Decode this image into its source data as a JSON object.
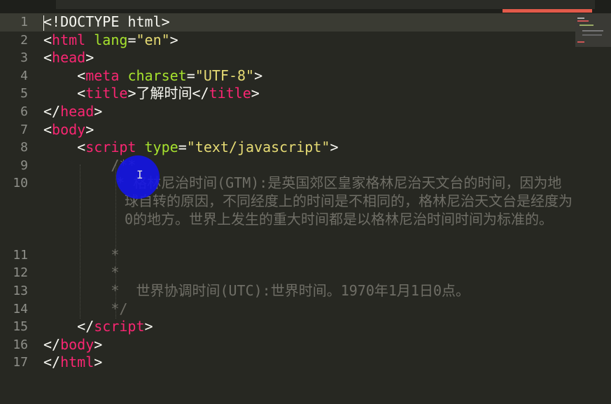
{
  "editor": {
    "theme_colors": {
      "background": "#272822",
      "tag": "#f92672",
      "attribute": "#a6e22e",
      "string": "#e6db74",
      "text": "#f8f8f2",
      "comment": "#6f6e66",
      "gutter": "#8f908a",
      "active_tab": "#e25a4a"
    },
    "lines": [
      {
        "n": "1",
        "tokens": [
          [
            "text",
            "<!DOCTYPE html>"
          ]
        ]
      },
      {
        "n": "2",
        "tokens": [
          [
            "text",
            "<"
          ],
          [
            "tag",
            "html"
          ],
          [
            "text",
            " "
          ],
          [
            "attr",
            "lang"
          ],
          [
            "text",
            "="
          ],
          [
            "str",
            "\"en\""
          ],
          [
            "text",
            ">"
          ]
        ]
      },
      {
        "n": "3",
        "tokens": [
          [
            "text",
            "<"
          ],
          [
            "tag",
            "head"
          ],
          [
            "text",
            ">"
          ]
        ]
      },
      {
        "n": "4",
        "tokens": [
          [
            "text",
            "    <"
          ],
          [
            "tag",
            "meta"
          ],
          [
            "text",
            " "
          ],
          [
            "attr",
            "charset"
          ],
          [
            "text",
            "="
          ],
          [
            "str",
            "\"UTF-8\""
          ],
          [
            "text",
            ">"
          ]
        ]
      },
      {
        "n": "5",
        "tokens": [
          [
            "text",
            "    <"
          ],
          [
            "tag",
            "title"
          ],
          [
            "text",
            ">了解时间</"
          ],
          [
            "tag",
            "title"
          ],
          [
            "text",
            ">"
          ]
        ]
      },
      {
        "n": "6",
        "tokens": [
          [
            "text",
            "</"
          ],
          [
            "tag",
            "head"
          ],
          [
            "text",
            ">"
          ]
        ]
      },
      {
        "n": "7",
        "tokens": [
          [
            "text",
            "<"
          ],
          [
            "tag",
            "body"
          ],
          [
            "text",
            ">"
          ]
        ]
      },
      {
        "n": "8",
        "tokens": [
          [
            "text",
            "    <"
          ],
          [
            "tag",
            "script"
          ],
          [
            "text",
            " "
          ],
          [
            "attr",
            "type"
          ],
          [
            "text",
            "="
          ],
          [
            "str",
            "\"text/javascript\""
          ],
          [
            "text",
            ">"
          ]
        ]
      },
      {
        "n": "9",
        "tokens": [
          [
            "cm",
            "        /**"
          ]
        ]
      },
      {
        "n": "10",
        "wrapped": true,
        "tokens": [
          [
            "cm",
            "* 格林尼治时间(GTM):是英国郊区皇家格林尼治天文台的时间，因为地球自转的原因，不同经度上的时间是不相同的，格林尼治天文台是经度为0的地方。世界上发生的重大时间都是以格林尼治时间时间为标准的。"
          ]
        ]
      },
      {
        "n": "11",
        "tokens": [
          [
            "cm",
            "        *"
          ]
        ]
      },
      {
        "n": "12",
        "tokens": [
          [
            "cm",
            "        *"
          ]
        ]
      },
      {
        "n": "13",
        "tokens": [
          [
            "cm",
            "        *  世界协调时间(UTC):世界时间。1970年1月1日0点。"
          ]
        ]
      },
      {
        "n": "14",
        "tokens": [
          [
            "cm",
            "        */"
          ]
        ]
      },
      {
        "n": "15",
        "tokens": [
          [
            "text",
            "    </"
          ],
          [
            "tag",
            "script"
          ],
          [
            "text",
            ">"
          ]
        ]
      },
      {
        "n": "16",
        "tokens": [
          [
            "text",
            "</"
          ],
          [
            "tag",
            "body"
          ],
          [
            "text",
            ">"
          ]
        ]
      },
      {
        "n": "17",
        "tokens": [
          [
            "text",
            "</"
          ],
          [
            "tag",
            "html"
          ],
          [
            "text",
            ">"
          ]
        ]
      }
    ]
  }
}
